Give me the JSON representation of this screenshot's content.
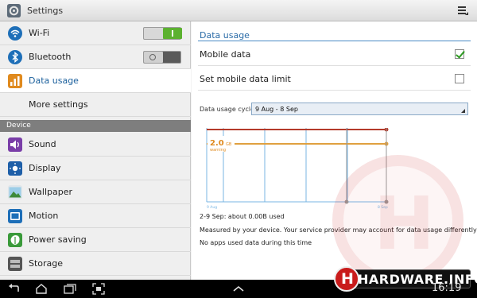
{
  "app": {
    "title": "Settings",
    "icon": "settings-app-icon"
  },
  "sidebar": {
    "items": [
      {
        "label": "Wi-Fi",
        "icon": "wifi-icon",
        "color": "#1e6fb8",
        "toggle": "on"
      },
      {
        "label": "Bluetooth",
        "icon": "bluetooth-icon",
        "color": "#1e6fb8",
        "toggle": "off"
      },
      {
        "label": "Data usage",
        "icon": "data-usage-icon",
        "color": "#e08a1e",
        "selected": true
      },
      {
        "label": "More settings",
        "icon": "none"
      }
    ],
    "section": "Device",
    "device_items": [
      {
        "label": "Sound",
        "icon": "sound-icon",
        "color": "#7a3ea8"
      },
      {
        "label": "Display",
        "icon": "display-icon",
        "color": "#1e5fa8"
      },
      {
        "label": "Wallpaper",
        "icon": "wallpaper-icon",
        "color": "#3d8a3a"
      },
      {
        "label": "Motion",
        "icon": "motion-icon",
        "color": "#1e6fb8"
      },
      {
        "label": "Power saving",
        "icon": "power-saving-icon",
        "color": "#3a9a3a"
      },
      {
        "label": "Storage",
        "icon": "storage-icon",
        "color": "#555555"
      }
    ]
  },
  "content": {
    "title": "Data usage",
    "mobile_data": {
      "label": "Mobile data",
      "checked": true
    },
    "data_limit": {
      "label": "Set mobile data limit",
      "checked": false
    },
    "cycle": {
      "label": "Data usage cycle",
      "value": "9 Aug - 8 Sep"
    },
    "chart": {
      "warning_value": "2.0",
      "warning_unit": "GB",
      "warning_label": "warning",
      "start_label": "9 Aug",
      "end_label": "8 Sep"
    },
    "summary": "2-9 Sep: about 0.00B used",
    "note": "Measured by your device. Your service provider may account for data usage differently",
    "no_apps": "No apps used data during this time"
  },
  "watermark": {
    "brand": "HARDWARE.INFO",
    "brand_initial": "H"
  },
  "status": {
    "time": "16:19"
  },
  "colors": {
    "accent": "#2a6ba7",
    "limit_line": "#b43a2a",
    "warning_line": "#e0a040",
    "grid": "#79b6e3"
  }
}
